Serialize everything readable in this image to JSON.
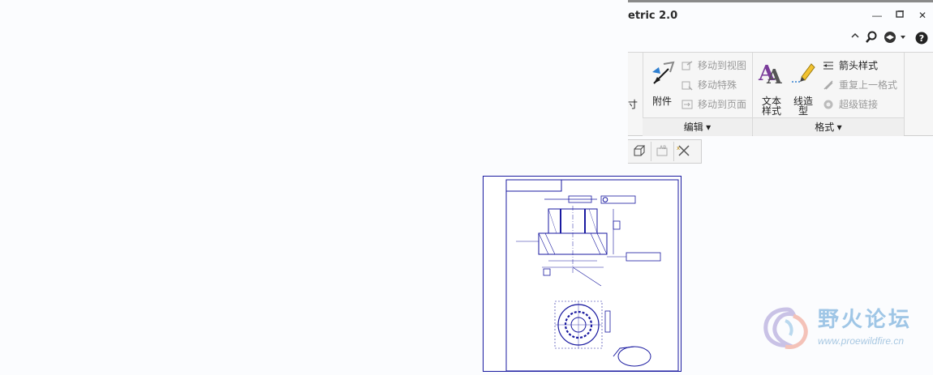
{
  "window": {
    "title": "etric 2.0"
  },
  "ribbon": {
    "partial_label": "寸",
    "attach": {
      "label": "附件"
    },
    "move_items": [
      {
        "label": "移动到视图",
        "enabled": false
      },
      {
        "label": "移动特殊",
        "enabled": false
      },
      {
        "label": "移动到页面",
        "enabled": false
      }
    ],
    "text_style": {
      "label_line1": "文本",
      "label_line2": "样式"
    },
    "line_style": {
      "label_line1": "线造",
      "label_line2": "型"
    },
    "format_items": [
      {
        "label": "箭头样式",
        "enabled": true
      },
      {
        "label": "重复上一格式",
        "enabled": false
      },
      {
        "label": "超级链接",
        "enabled": false
      }
    ],
    "groups": {
      "edit": "编辑",
      "format": "格式"
    }
  },
  "watermark": {
    "name": "野火论坛",
    "url": "www.proewildfire.cn"
  },
  "colors": {
    "accent": "#1a1aa0",
    "ribbon_bg": "#f6f6f6"
  }
}
